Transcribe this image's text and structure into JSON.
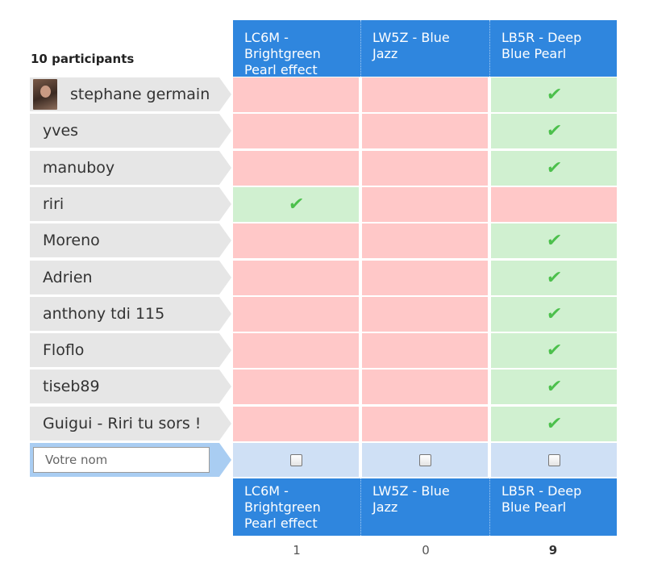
{
  "poll": {
    "participants_count_label": "10 participants",
    "columns": [
      {
        "label": "LC6M - Brightgreen Pearl effect",
        "total": "1"
      },
      {
        "label": "LW5Z - Blue Jazz",
        "total": "0"
      },
      {
        "label": "LB5R - Deep Blue Pearl",
        "total": "9"
      }
    ],
    "participants": [
      {
        "name": "stephane germain",
        "has_avatar": true,
        "votes": [
          "no",
          "no",
          "yes"
        ]
      },
      {
        "name": "yves",
        "has_avatar": false,
        "votes": [
          "no",
          "no",
          "yes"
        ]
      },
      {
        "name": "manuboy",
        "has_avatar": false,
        "votes": [
          "no",
          "no",
          "yes"
        ]
      },
      {
        "name": "riri",
        "has_avatar": false,
        "votes": [
          "yes",
          "no",
          "no"
        ]
      },
      {
        "name": "Moreno",
        "has_avatar": false,
        "votes": [
          "no",
          "no",
          "yes"
        ]
      },
      {
        "name": "Adrien",
        "has_avatar": false,
        "votes": [
          "no",
          "no",
          "yes"
        ]
      },
      {
        "name": "anthony tdi 115",
        "has_avatar": false,
        "votes": [
          "no",
          "no",
          "yes"
        ]
      },
      {
        "name": "Floflo",
        "has_avatar": false,
        "votes": [
          "no",
          "no",
          "yes"
        ]
      },
      {
        "name": "tiseb89",
        "has_avatar": false,
        "votes": [
          "no",
          "no",
          "yes"
        ]
      },
      {
        "name": "Guigui - Riri tu sors !",
        "has_avatar": false,
        "votes": [
          "no",
          "no",
          "yes"
        ]
      }
    ],
    "new_participant": {
      "placeholder": "Votre nom",
      "value": ""
    },
    "check_glyph": "✔",
    "colors": {
      "header": "#2f86de",
      "yes": "#d0f0d0",
      "no": "#ffc8c8",
      "check": "#4cc04c",
      "input_row": "#cfe0f5"
    }
  }
}
